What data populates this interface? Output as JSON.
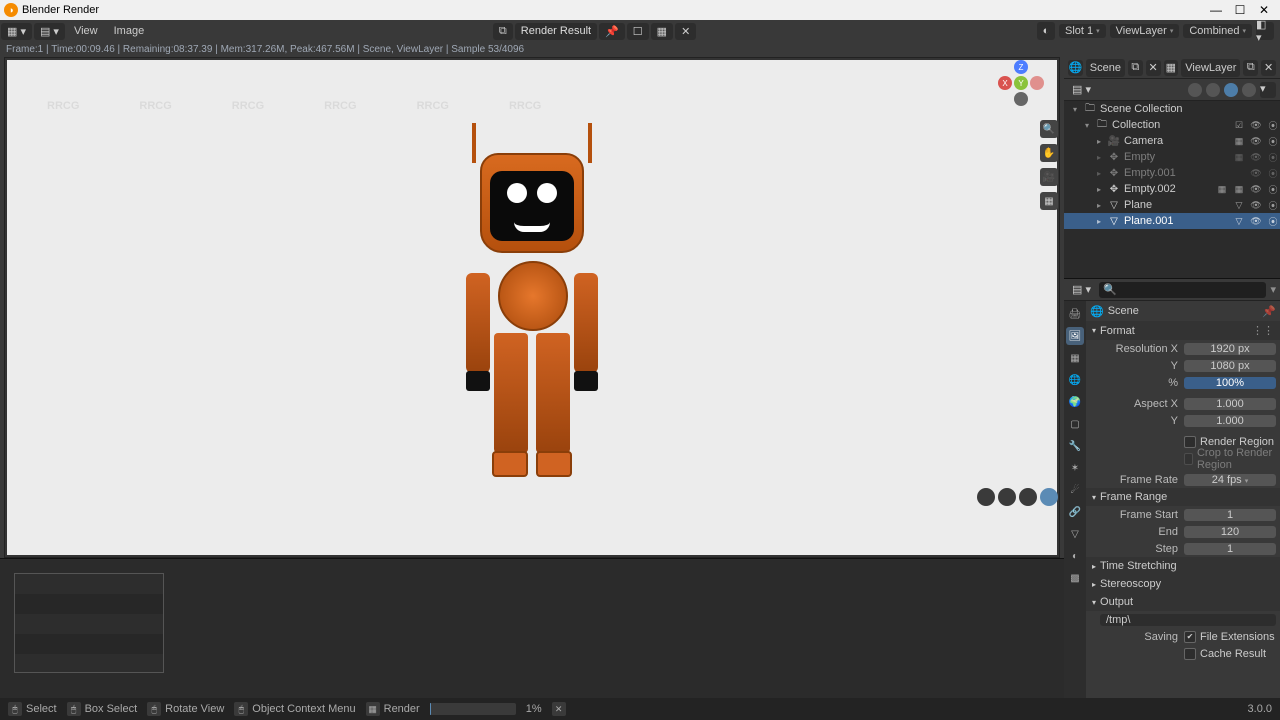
{
  "window": {
    "title": "Blender Render",
    "min": "—",
    "max": "☐",
    "close": "✕"
  },
  "menubar": {
    "view": "View",
    "image": "Image",
    "header": "Render Result",
    "slot": "Slot 1",
    "viewlayer": "ViewLayer",
    "pass": "Combined"
  },
  "status_line": "Frame:1 | Time:00:09.46 | Remaining:08:37.39 | Mem:317.26M, Peak:467.56M | Scene, ViewLayer | Sample 53/4096",
  "scene_fields": {
    "scene": "Scene",
    "viewlayer": "ViewLayer"
  },
  "outliner": {
    "root": "Scene Collection",
    "collection": "Collection",
    "items": [
      {
        "name": "Camera",
        "icon": "🎥",
        "indent": 2
      },
      {
        "name": "Empty",
        "icon": "✥",
        "indent": 2,
        "faded": true
      },
      {
        "name": "Empty.001",
        "icon": "✥",
        "indent": 2,
        "faded": true
      },
      {
        "name": "Empty.002",
        "icon": "✥",
        "indent": 2
      },
      {
        "name": "Plane",
        "icon": "▽",
        "indent": 2
      },
      {
        "name": "Plane.001",
        "icon": "▽",
        "indent": 2,
        "selected": true
      }
    ]
  },
  "props": {
    "crumb": "Scene",
    "format": {
      "title": "Format",
      "res_x_label": "Resolution X",
      "res_x": "1920 px",
      "res_y_label": "Y",
      "res_y": "1080 px",
      "pct_label": "%",
      "pct": "100%",
      "aspect_x_label": "Aspect X",
      "aspect_x": "1.000",
      "aspect_y_label": "Y",
      "aspect_y": "1.000",
      "render_region_label": "Render Region",
      "crop_label": "Crop to Render Region",
      "frame_rate_label": "Frame Rate",
      "frame_rate": "24 fps"
    },
    "frame_range": {
      "title": "Frame Range",
      "start_label": "Frame Start",
      "start": "1",
      "end_label": "End",
      "end": "120",
      "step_label": "Step",
      "step": "1"
    },
    "time_stretch": "Time Stretching",
    "stereo": "Stereoscopy",
    "output": {
      "title": "Output",
      "path": "/tmp\\",
      "saving_label": "Saving",
      "file_ext_label": "File Extensions",
      "cache_label": "Cache Result"
    }
  },
  "statusbar": {
    "select": "Select",
    "box": "Box Select",
    "rotate": "Rotate View",
    "ctx": "Object Context Menu",
    "render": "Render",
    "pct": "1%",
    "version": "3.0.0"
  }
}
